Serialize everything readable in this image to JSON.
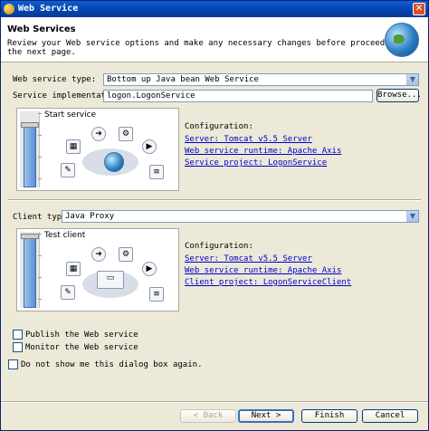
{
  "window": {
    "title": "Web Service"
  },
  "header": {
    "title": "Web Services",
    "description": "Review your Web service options and make any necessary changes before proceeding to the next page."
  },
  "service": {
    "type_label": "Web service type:",
    "type_value": "Bottom up Java bean Web Service",
    "impl_label": "Service implementation:",
    "impl_value": "logon.LogonService",
    "browse_label": "Browse...",
    "panel_title": "Start service",
    "config_label": "Configuration:",
    "links": [
      "Server: Tomcat v5.5 Server",
      "Web service runtime: Apache Axis",
      "Service project: LogonService"
    ]
  },
  "client": {
    "type_label": "Client type:",
    "type_value": "Java Proxy",
    "panel_title": "Test client",
    "config_label": "Configuration:",
    "links": [
      "Server: Tomcat v5.5 Server",
      "Web service runtime: Apache Axis",
      "Client project: LogonServiceClient"
    ]
  },
  "options": {
    "publish_label": "Publish the Web service",
    "monitor_label": "Monitor the Web service",
    "dont_show_label": "Do not show me this dialog box again."
  },
  "buttons": {
    "back": "< Back",
    "next": "Next >",
    "finish": "Finish",
    "cancel": "Cancel"
  }
}
